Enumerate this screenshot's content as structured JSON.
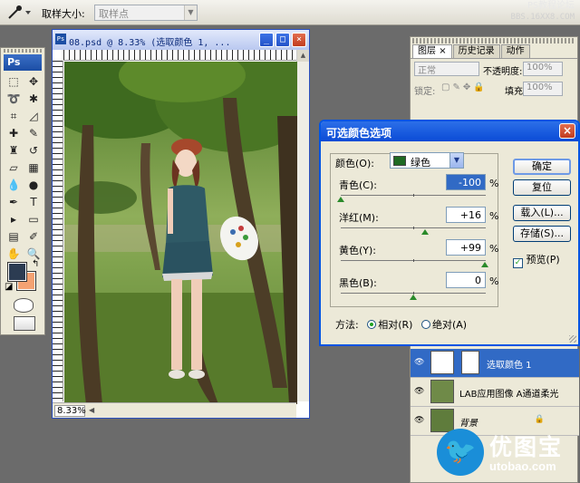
{
  "options_bar": {
    "sample_size_label": "取样大小:",
    "sample_size_value": "取样点",
    "watermark_line1": "PS教程论坛",
    "watermark_line2": "BBS.16XX8.COM"
  },
  "toolbox": {
    "logo": "Ps"
  },
  "document": {
    "title": "08.psd @ 8.33% (选取颜色 1, ...",
    "zoom": "8.33%"
  },
  "layers_panel": {
    "tabs": [
      "图层",
      "历史记录",
      "动作"
    ],
    "blend_mode": "正常",
    "opacity_label": "不透明度:",
    "opacity_value": "100%",
    "lock_label": "锁定:",
    "fill_label": "填充:",
    "fill_value": "100%",
    "layers": [
      {
        "name": "选取颜色 1",
        "selected": true
      },
      {
        "name": "LAB应用图像 A通道柔光",
        "selected": false
      },
      {
        "name": "背景",
        "selected": false
      }
    ]
  },
  "dialog": {
    "title": "可选颜色选项",
    "colors_label": "颜色(O):",
    "colors_value": "绿色",
    "sliders": [
      {
        "label": "青色(C):",
        "value": "-100",
        "percent": -100
      },
      {
        "label": "洋红(M):",
        "value": "+16",
        "percent": 16
      },
      {
        "label": "黄色(Y):",
        "value": "+99",
        "percent": 99
      },
      {
        "label": "黑色(B):",
        "value": "0",
        "percent": 0
      }
    ],
    "percent_sign": "%",
    "method_label": "方法:",
    "method_relative": "相对(R)",
    "method_absolute": "绝对(A)",
    "buttons": {
      "ok": "确定",
      "reset": "复位",
      "load": "载入(L)...",
      "save": "存储(S)..."
    },
    "preview_label": "预览(P)"
  },
  "logo": {
    "brand": "优图宝",
    "url": "utobao.com"
  },
  "colors": {
    "foreground": "#2c3c52",
    "background": "#f4a272",
    "selection": "#316ac5",
    "titlebar": "#0a4bd6"
  }
}
